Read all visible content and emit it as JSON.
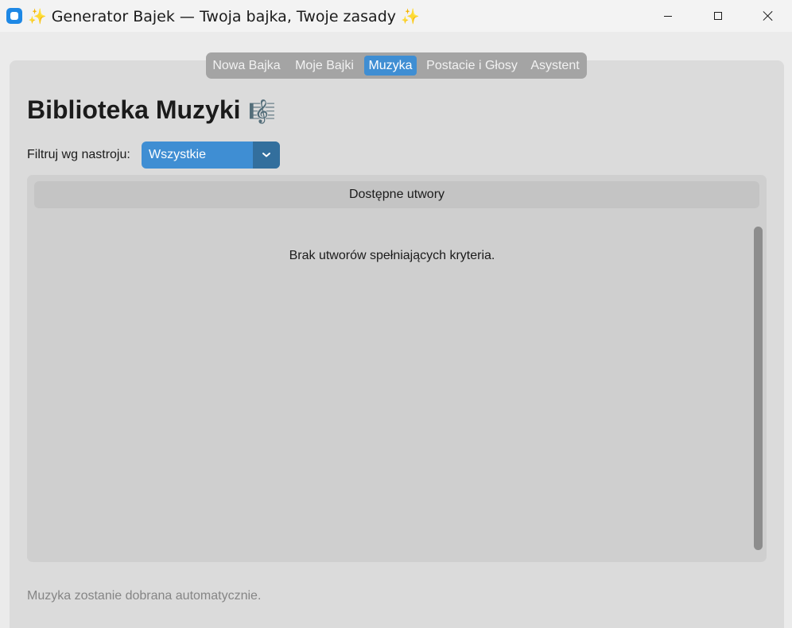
{
  "window": {
    "title": "✨ Generator Bajek — Twoja bajka, Twoje zasady ✨",
    "minimize_icon": "minimize-icon",
    "maximize_icon": "maximize-icon",
    "close_icon": "close-icon"
  },
  "tabs": [
    {
      "label": "Nowa Bajka",
      "active": false
    },
    {
      "label": "Moje Bajki",
      "active": false
    },
    {
      "label": "Muzyka",
      "active": true
    },
    {
      "label": "Postacie i Głosy",
      "active": false
    },
    {
      "label": "Asystent",
      "active": false
    }
  ],
  "page": {
    "title": "Biblioteka Muzyki",
    "title_icon": "🎼"
  },
  "filter": {
    "label": "Filtruj wg nastroju:",
    "selected": "Wszystkie"
  },
  "tracks": {
    "header": "Dostępne utwory",
    "empty_message": "Brak utworów spełniających kryteria."
  },
  "footer": {
    "note": "Muzyka zostanie dobrana automatycznie."
  },
  "colors": {
    "accent": "#3f8ed3",
    "accent_dark": "#336f9d",
    "panel": "#dbdbdb",
    "tabbar": "#a4a4a4"
  }
}
